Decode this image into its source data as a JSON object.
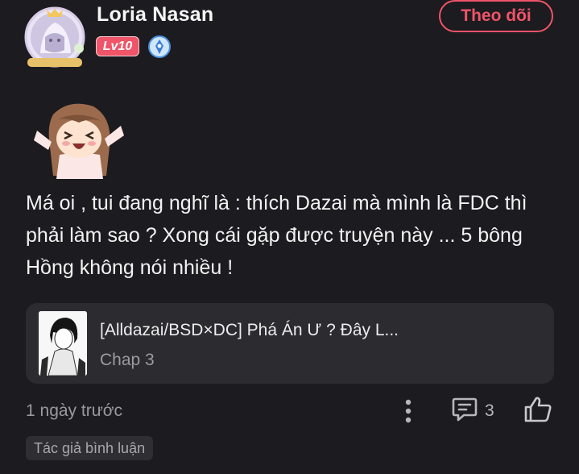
{
  "comment": {
    "user": {
      "name": "Loria Nasan",
      "level": "Lv10",
      "avatar_caption": "LORIA NASAN"
    },
    "follow_label": "Theo dõi",
    "text": "Má oi , tui đang nghĩ là : thích Dazai mà mình là FDC thì phải làm sao ? Xong cái gặp được truyện này ... 5 bông Hồng không nói nhiều !",
    "story": {
      "title": "[Alldazai/BSD×DC] Phá Án Ư ? Đây L...",
      "chapter": "Chap 3"
    },
    "timestamp": "1 ngày trước",
    "reply_count": "3",
    "author_tag": "Tác giả bình luận"
  },
  "colors": {
    "background": "#1c1b1f",
    "accent": "#ef5468",
    "card": "#2c2b2f",
    "muted_text": "#9a9a9e"
  },
  "icons": [
    "verified-icon",
    "more-vertical-icon",
    "comment-icon",
    "like-icon"
  ]
}
